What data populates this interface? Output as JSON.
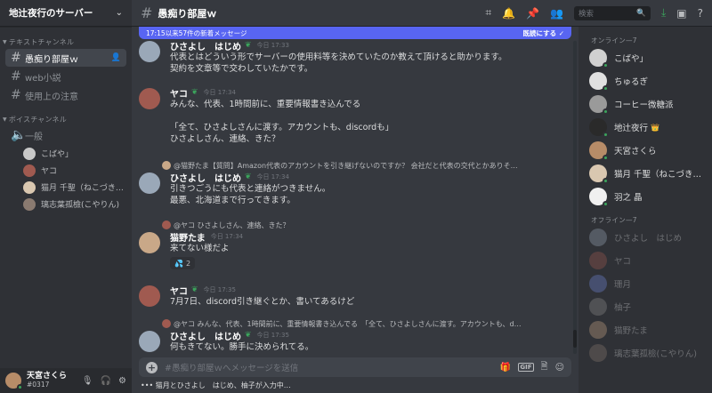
{
  "server": {
    "name": "地辻夜行のサーバー"
  },
  "sidebar": {
    "text_category": "テキストチャンネル",
    "text_channels": [
      {
        "name": "愚痴り部屋ｗ"
      },
      {
        "name": "web小説"
      },
      {
        "name": "使用上の注意"
      }
    ],
    "voice_category": "ボイスチャンネル",
    "voice_channel": "一般",
    "voice_users": [
      {
        "name": "こばや」",
        "color": "#c8c8c8"
      },
      {
        "name": "ヤコ",
        "color": "#a05a50"
      },
      {
        "name": "猫月 千聖（ねこづき…",
        "color": "#d9c7b0"
      },
      {
        "name": "璃志葉孤檢(こやりん)",
        "color": "#8a7a70"
      }
    ]
  },
  "user_panel": {
    "name": "天宮さくら",
    "tag": "#0317"
  },
  "topbar": {
    "channel": "愚痴り部屋ｗ",
    "search_placeholder": "検索"
  },
  "chat": {
    "new_messages": "17:15以来57件の新着メッセージ",
    "mark_read": "既読にする",
    "messages": [
      {
        "author": "ひさよし　はじめ",
        "time": "今日 17:33",
        "lines": [
          "代表とはどういう形でサーバーの使用料等を決めていたのか教えて頂けると助かります。",
          "契約を文章等で交わしていたかです。"
        ]
      },
      {
        "author": "ヤコ",
        "time": "今日 17:34",
        "lines": [
          "みんな、代表、1時間前に、重要情報書き込んでる",
          "",
          "「全て、ひさよしさんに渡す。アカウントも、discordも」",
          "ひさよしさん、連絡、きた？"
        ]
      },
      {
        "reply": "@猫野たま【質問】Amazon代表のアカウントを引き継げないのですか？ 会社だと代表の交代とかありそ…",
        "author": "ひさよし　はじめ",
        "time": "今日 17:34",
        "lines": [
          "引きつごうにも代表と連絡がつきません。",
          "最悪、北海道まで行ってきます。"
        ]
      },
      {
        "reply": "@ヤコ ひさよしさん、連絡、きた？",
        "author": "猫野たま",
        "time": "今日 17:34",
        "lines": [
          "来てない様だよ"
        ],
        "reaction": {
          "emoji": "💦",
          "count": "2"
        }
      },
      {
        "author": "ヤコ",
        "time": "今日 17:35",
        "lines": [
          "7月7日、discord引き継ぐとか、書いてあるけど"
        ]
      },
      {
        "reply": "@ヤコ みんな、代表、1時間前に、重要情報書き込んでる　「全て、ひさよしさんに渡す。アカウントも、d…",
        "author": "ひさよし　はじめ",
        "time": "今日 17:35",
        "lines": [
          "何もきてない。勝手に決められてる。"
        ]
      }
    ],
    "composer_placeholder": "#愚痴り部屋ｗへメッセージを送信",
    "gif_label": "GIF",
    "typing": "猫月とひさよし　はじめ、柚子が入力中…"
  },
  "members": {
    "online_label": "オンライン—7",
    "online": [
      {
        "name": "こばや」",
        "color": "#d0d0d0"
      },
      {
        "name": "ちゅるぎ",
        "color": "#e0e0e0"
      },
      {
        "name": "コーヒー微糖派",
        "color": "#9a9a9a"
      },
      {
        "name": "地辻夜行",
        "color": "#2a2a2a",
        "crown": "👑"
      },
      {
        "name": "天宮さくら",
        "color": "#b78c68"
      },
      {
        "name": "猫月 千聖（ねこづき…",
        "color": "#d9c7b0"
      },
      {
        "name": "羽之 晶",
        "color": "#f0f0f0"
      }
    ],
    "offline_label": "オフライン—7",
    "offline": [
      {
        "name": "ひさよし　はじめ",
        "color": "#9aa8b8"
      },
      {
        "name": "ヤコ",
        "color": "#a05a50"
      },
      {
        "name": "珊月",
        "color": "#7289da"
      },
      {
        "name": "柚子",
        "color": "#8e8e8e"
      },
      {
        "name": "猫野たま",
        "color": "#c9a888"
      },
      {
        "name": "璃志葉孤檢(こやりん)",
        "color": "#8a7a70"
      }
    ]
  }
}
